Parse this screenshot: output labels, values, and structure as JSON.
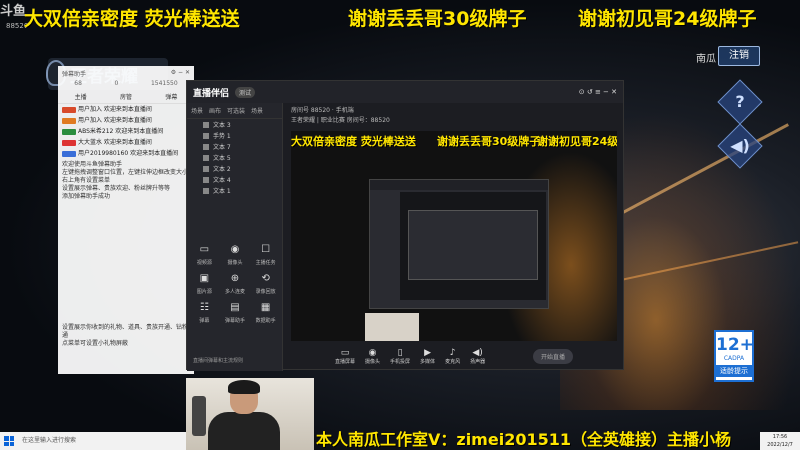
{
  "overlay": {
    "top_left_text": "大双倍亲密度 荧光棒送送",
    "top_mid_text": "谢谢丢丢哥30级牌子",
    "top_right_text": "谢谢初见哥24级牌子",
    "bottom_text": "本人南瓜工作室V：zimei201511（全英雄接）主播小杨",
    "corner_logo": "斗鱼",
    "corner_id": "88520"
  },
  "game_logo": "王者荣耀",
  "header": {
    "username": "南瓜",
    "logout_label": "注销"
  },
  "side_buttons": {
    "help_icon": "?",
    "sound_icon": "◀)"
  },
  "age_badge": {
    "rating": "12+",
    "org": "CADPA",
    "label": "适龄提示"
  },
  "chat": {
    "title": "弹幕助手",
    "stats": [
      "68",
      "0",
      "1541550"
    ],
    "tabs": [
      "主播",
      "房管",
      "弹幕"
    ],
    "messages": [
      {
        "text": "用户加入 欢迎来到本直播间",
        "color": "#d84a2a"
      },
      {
        "text": "用户加入 欢迎来到本直播间",
        "color": "#e07b22"
      },
      {
        "text": "ABS米希212 欢迎来到本直播间",
        "color": "#2a8d3e"
      },
      {
        "text": "大大蓝水 欢迎来到本直播间",
        "color": "#d33"
      },
      {
        "text": "用户2019980160 欢迎来到本直播间",
        "color": "#3a6ed8"
      }
    ],
    "notes": [
      "欢迎使用斗鱼弹幕助手",
      "左键拖拽调整窗口位置，左键拉伸边框改变大小",
      "右上角有设置菜单",
      "设置展示弹幕、贵族欢迎、粉丝牌升等等",
      "添加弹幕助手成功"
    ],
    "notes2": [
      "设置展示你收到的礼物、道具、贵族开通、钻粉开通",
      "点菜单可设置小礼物屏蔽"
    ]
  },
  "obs": {
    "brand": "直播伴侣",
    "badge": "测试",
    "tabs": [
      "场景",
      "画布",
      "可选装",
      "场景"
    ],
    "scenes": [
      "文本 3",
      "手势 1",
      "文本 7",
      "文本 5",
      "文本 2",
      "文本 4",
      "文本 1"
    ],
    "tools": [
      "视频源",
      "摄像头",
      "主播任务",
      "图片源",
      "多人连麦",
      "录像回放",
      "弹幕",
      "弹幕助手",
      "数据助手"
    ],
    "footer_label": "直播间弹幕和主流规则",
    "info_line1": "房间号 88520 · 手机端",
    "info_line2": "王者荣耀 | 职业比赛  房间号：88520",
    "bottom": [
      "直播屏幕",
      "摄像头",
      "手机投屏",
      "多媒体",
      "麦克风",
      "扬声器"
    ],
    "live_label": "开始直播"
  },
  "taskbar": {
    "search": "在这里输入进行搜索",
    "time": "17:56",
    "date": "2022/12/7"
  }
}
